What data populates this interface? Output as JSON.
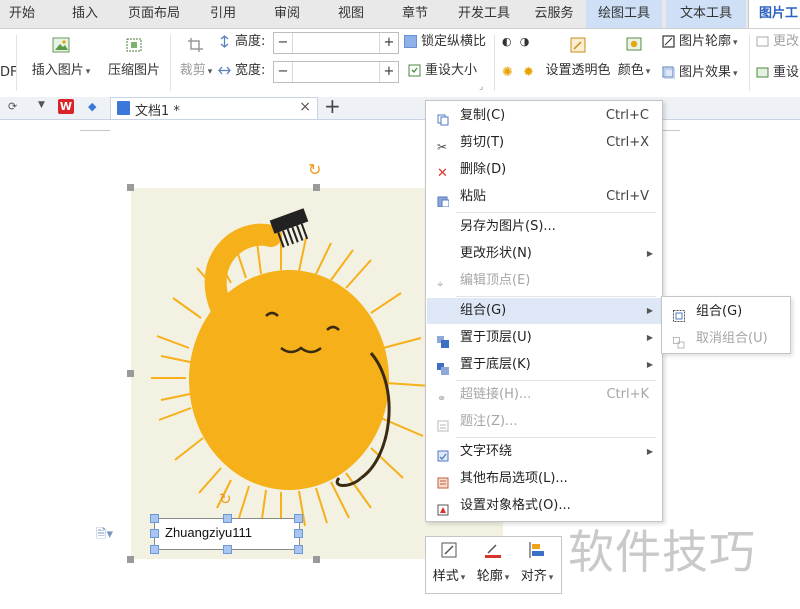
{
  "tabs": [
    "开始",
    "插入",
    "页面布局",
    "引用",
    "审阅",
    "视图",
    "章节",
    "开发工具",
    "云服务",
    "绘图工具",
    "文本工具",
    "图片工"
  ],
  "ribbon": {
    "pdf_fragment": "DF",
    "insert_picture": "插入图片",
    "compress_picture": "压缩图片",
    "crop": "裁剪",
    "height_label": "高度:",
    "width_label": "宽度:",
    "spin_minus": "−",
    "spin_plus": "+",
    "height_value": "",
    "width_value": "",
    "lock_ratio": "锁定纵横比",
    "reset_size": "重设大小",
    "set_transparent": "设置透明色",
    "color": "颜色",
    "picture_outline": "图片轮廓",
    "picture_effect": "图片效果",
    "change_picture": "更改",
    "reset_picture": "重设"
  },
  "docbar": {
    "wps_logo": "W",
    "doc_title": "文档1 *",
    "close": "×",
    "new_tab": "+"
  },
  "canvas": {
    "textbox_text": "Zhuangziyu111"
  },
  "context_menu": {
    "items": [
      {
        "label": "复制(C)",
        "shortcut": "Ctrl+C",
        "icon": "copy-icon"
      },
      {
        "label": "剪切(T)",
        "shortcut": "Ctrl+X",
        "icon": "scissors-icon"
      },
      {
        "label": "删除(D)",
        "shortcut": "",
        "icon": "delete-icon"
      },
      {
        "label": "粘贴",
        "shortcut": "Ctrl+V",
        "icon": "paste-icon"
      },
      {
        "label": "另存为图片(S)...",
        "shortcut": "",
        "icon": ""
      },
      {
        "label": "更改形状(N)",
        "shortcut": "",
        "icon": ""
      },
      {
        "label": "编辑顶点(E)",
        "shortcut": "",
        "icon": "edit-points-icon"
      },
      {
        "label": "组合(G)",
        "shortcut": "",
        "icon": ""
      },
      {
        "label": "置于顶层(U)",
        "shortcut": "",
        "icon": "bring-front-icon"
      },
      {
        "label": "置于底层(K)",
        "shortcut": "",
        "icon": "send-back-icon"
      },
      {
        "label": "超链接(H)...",
        "shortcut": "Ctrl+K",
        "icon": "hyperlink-icon"
      },
      {
        "label": "题注(Z)...",
        "shortcut": "",
        "icon": "caption-icon"
      },
      {
        "label": "文字环绕",
        "shortcut": "",
        "icon": "text-wrap-icon"
      },
      {
        "label": "其他布局选项(L)...",
        "shortcut": "",
        "icon": "layout-options-icon"
      },
      {
        "label": "设置对象格式(O)...",
        "shortcut": "",
        "icon": "format-object-icon"
      }
    ]
  },
  "submenu": {
    "group": "组合(G)",
    "ungroup": "取消组合(U)"
  },
  "mini_toolbar": {
    "style": "样式",
    "outline": "轮廓",
    "align": "对齐"
  },
  "watermark": "软件技巧",
  "colors": {
    "accent": "#2b62c0",
    "highlight": "#dde7f5",
    "sun": "#f5b01a",
    "paper": "#f3f1e2"
  }
}
